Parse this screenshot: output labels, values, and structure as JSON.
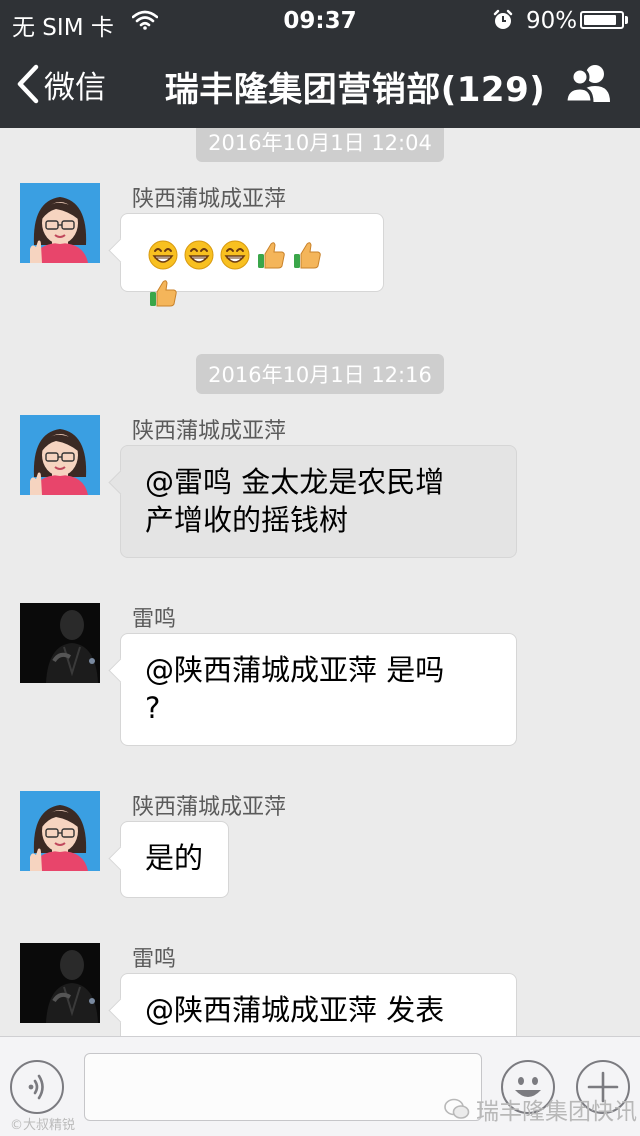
{
  "status_bar": {
    "carrier": "无 SIM 卡",
    "time": "09:37",
    "battery_percent": "90%",
    "battery_level": 0.9
  },
  "nav": {
    "back_label": "微信",
    "title": "瑞丰隆集团营销部(129)"
  },
  "messages": [
    {
      "type": "timestamp",
      "text": "2016年10月1日 12:04"
    },
    {
      "type": "message",
      "sender": "陕西蒲城成亚萍",
      "avatar": "cartoon-woman",
      "emojis": [
        "grin-emoji",
        "grin-emoji",
        "grin-emoji",
        "thumbs-up-emoji",
        "thumbs-up-emoji",
        "thumbs-up-emoji"
      ]
    },
    {
      "type": "timestamp",
      "text": "2016年10月1日 12:16"
    },
    {
      "type": "message",
      "sender": "陕西蒲城成亚萍",
      "avatar": "cartoon-woman",
      "lines": [
        "@雷鸣 金太龙是农民增",
        "产增收的摇钱树"
      ]
    },
    {
      "type": "message",
      "sender": "雷鸣",
      "avatar": "dark-photo",
      "lines": [
        "@陕西蒲城成亚萍 是吗",
        "?"
      ]
    },
    {
      "type": "message",
      "sender": "陕西蒲城成亚萍",
      "avatar": "cartoon-woman",
      "lines": [
        "是的"
      ]
    },
    {
      "type": "message",
      "sender": "雷鸣",
      "avatar": "dark-photo",
      "lines": [
        "@陕西蒲城成亚萍 发表"
      ]
    }
  ],
  "input_bar": {
    "voice_icon": "voice-icon",
    "emoji_icon": "smiley-icon",
    "plus_icon": "plus-icon"
  },
  "watermark": {
    "left": "©大叔精锐",
    "right": "瑞丰隆集团快讯"
  },
  "colors": {
    "nav_bg": "#2f3236",
    "chat_bg": "#ebebeb",
    "bubble_bg": "#ffffff",
    "selected_bubble_bg": "#e4e4e4"
  }
}
